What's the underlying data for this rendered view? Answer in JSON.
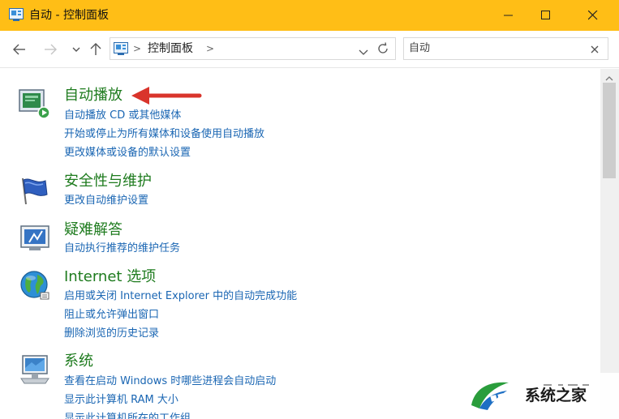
{
  "window": {
    "title": "自动 - 控制面板",
    "accent_color": "#ffbe16"
  },
  "address_bar": {
    "location": "控制面板",
    "separator": ">",
    "search_value": "自动"
  },
  "icons": {
    "app": "control-panel-icon",
    "minimize": "minimize-icon",
    "maximize": "maximize-icon",
    "close": "close-icon",
    "back": "back-arrow-icon",
    "forward": "forward-arrow-icon",
    "recent": "chevron-down-icon",
    "up": "up-arrow-icon",
    "refresh": "refresh-icon",
    "search_clear": "clear-icon"
  },
  "groups": [
    {
      "title": "自动播放",
      "icon": "autoplay-icon",
      "links": [
        "自动播放 CD 或其他媒体",
        "开始或停止为所有媒体和设备使用自动播放",
        "更改媒体或设备的默认设置"
      ]
    },
    {
      "title": "安全性与维护",
      "icon": "security-flag-icon",
      "links": [
        "更改自动维护设置"
      ]
    },
    {
      "title": "疑难解答",
      "icon": "troubleshoot-icon",
      "links": [
        "自动执行推荐的维护任务"
      ]
    },
    {
      "title": "Internet 选项",
      "icon": "internet-globe-icon",
      "links": [
        "启用或关闭 Internet Explorer 中的自动完成功能",
        "阻止或允许弹出窗口",
        "删除浏览的历史记录"
      ]
    },
    {
      "title": "系统",
      "icon": "system-computer-icon",
      "links": [
        "查看在启动 Windows 时哪些进程会自动启动",
        "显示此计算机 RAM 大小",
        "显示此计算机所在的工作组"
      ]
    }
  ],
  "watermark": {
    "text": "系统之家"
  },
  "colors": {
    "group_title": "#1e7b1e",
    "link": "#1a66b3",
    "annotation_arrow": "#d9342b"
  }
}
